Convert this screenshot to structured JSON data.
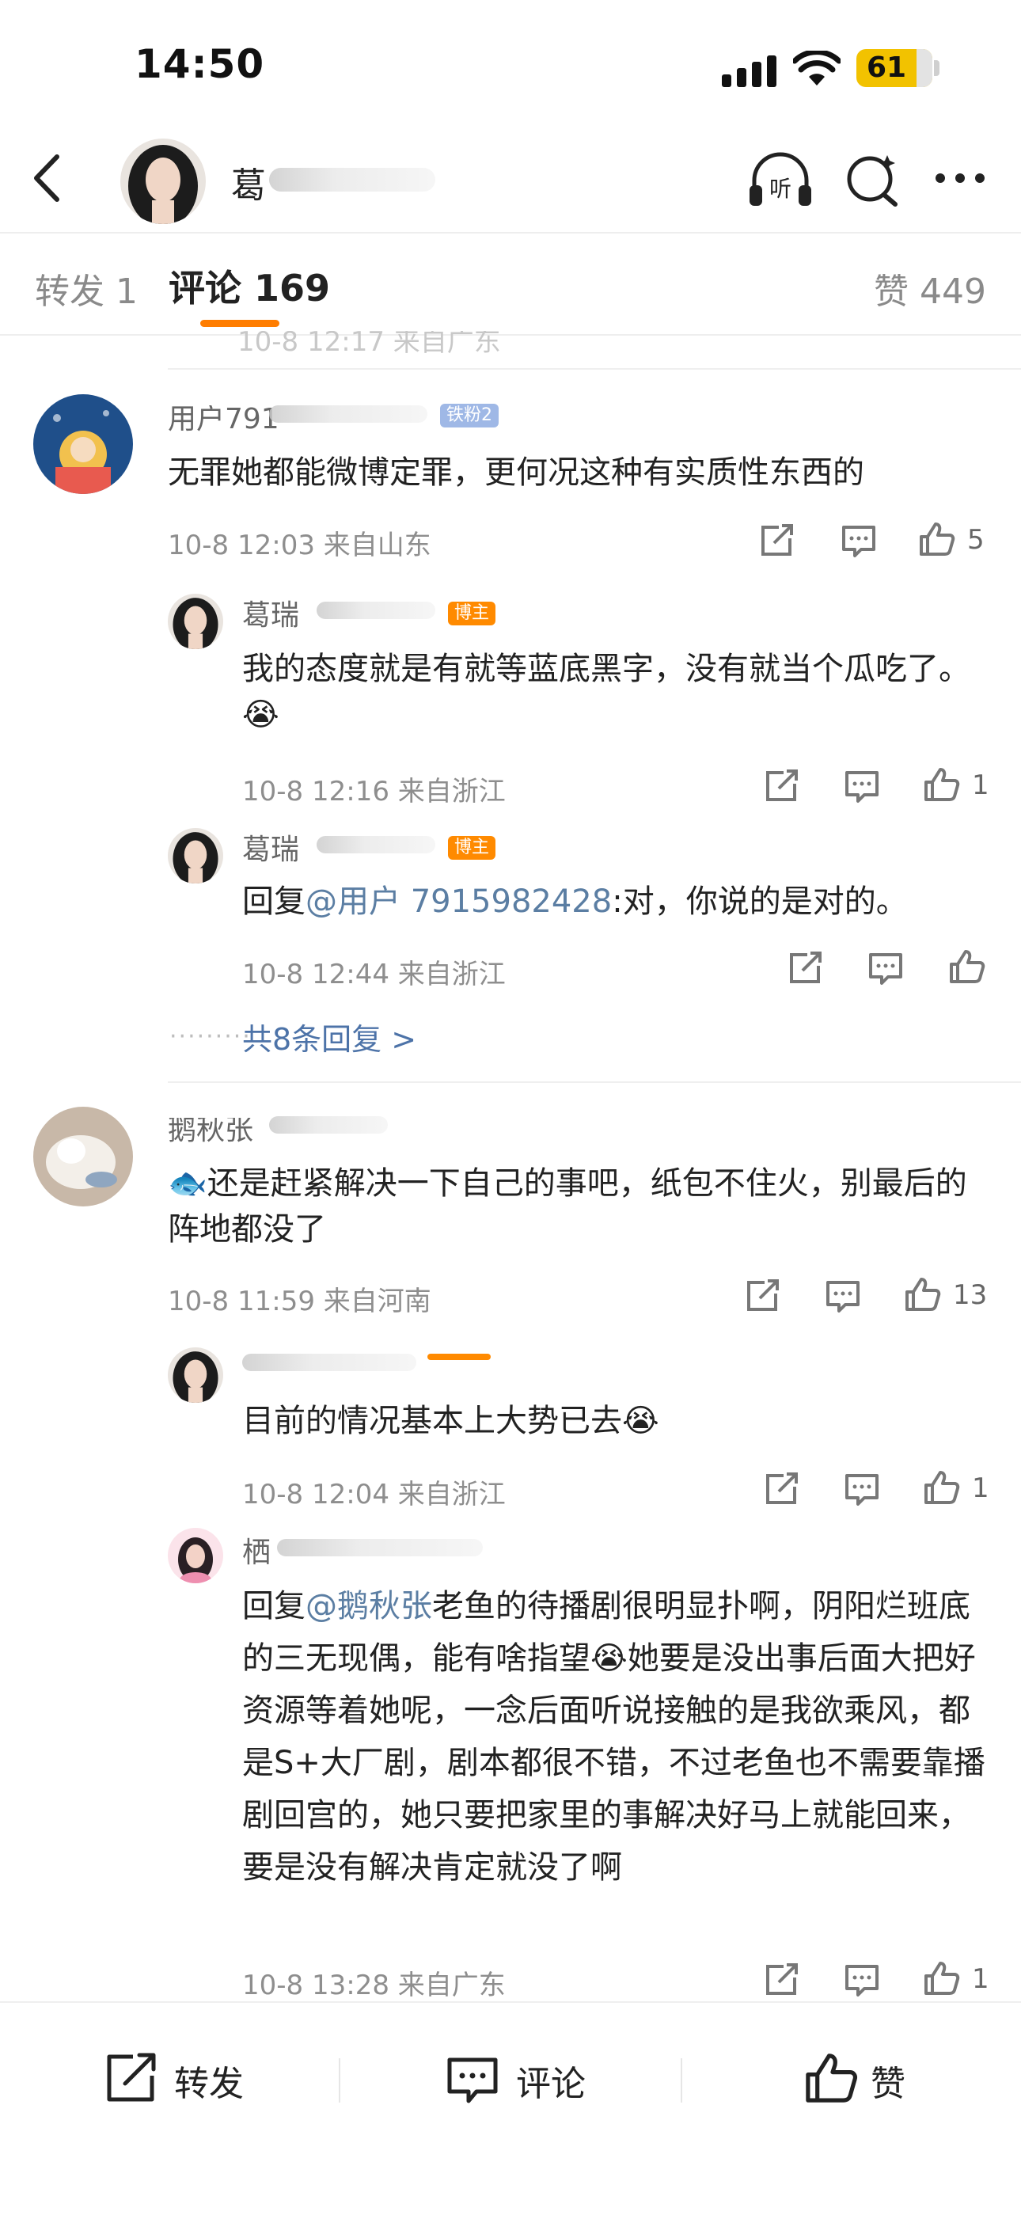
{
  "status_bar": {
    "time": "14:50",
    "battery": "61"
  },
  "nav": {
    "title": "葛"
  },
  "tabs": {
    "forward": "转发 1",
    "comments": "评论 169",
    "likes": "赞 449"
  },
  "cut_row_text": "10-8 12:17 来自广东",
  "comments": [
    {
      "username": "用户791",
      "badge": "铁粉2",
      "text": "无罪她都能微博定罪，更何况这种有实质性东西的",
      "meta": "10-8 12:03 来自山东",
      "likes": "5",
      "replies": [
        {
          "username": "葛瑞",
          "badge": "博主",
          "text": "我的态度就是有就等蓝底黑字，没有就当个瓜吃了。😭",
          "meta": "10-8 12:16 来自浙江",
          "likes": "1"
        },
        {
          "username": "葛瑞",
          "badge": "博主",
          "reply_prefix": "回复",
          "mention": "@用户 7915982428",
          "text": ":对，你说的是对的。",
          "meta": "10-8 12:44 来自浙江",
          "likes": ""
        }
      ],
      "more_replies": "共8条回复 >"
    },
    {
      "username": "鹅秋张",
      "text": "🐟还是赶紧解决一下自己的事吧，纸包不住火，别最后的阵地都没了",
      "meta": "10-8 11:59 来自河南",
      "likes": "13",
      "replies": [
        {
          "username": "",
          "text": "目前的情况基本上大势已去😭",
          "meta": "10-8 12:04 来自浙江",
          "likes": "1"
        },
        {
          "username": "栖",
          "reply_prefix": "回复",
          "mention": "@鹅秋张",
          "text": "老鱼的待播剧很明显扑啊，阴阳烂班底的三无现偶，能有啥指望😭她要是没出事后面大把好资源等着她呢，一念后面听说接触的是我欲乘风，都是S+大厂剧，剧本都很不错，不过老鱼也不需要靠播剧回宫的，她只要把家里的事解决好马上就能回来，要是没有解决肯定就没了啊",
          "meta": "10-8 13:28 来自广东",
          "likes": "1"
        }
      ]
    }
  ],
  "toolbar": {
    "forward": "转发",
    "comment": "评论",
    "like": "赞"
  },
  "colors": {
    "accent": "#ff7d00",
    "link": "#4d73a8",
    "battery": "#f2c200"
  }
}
